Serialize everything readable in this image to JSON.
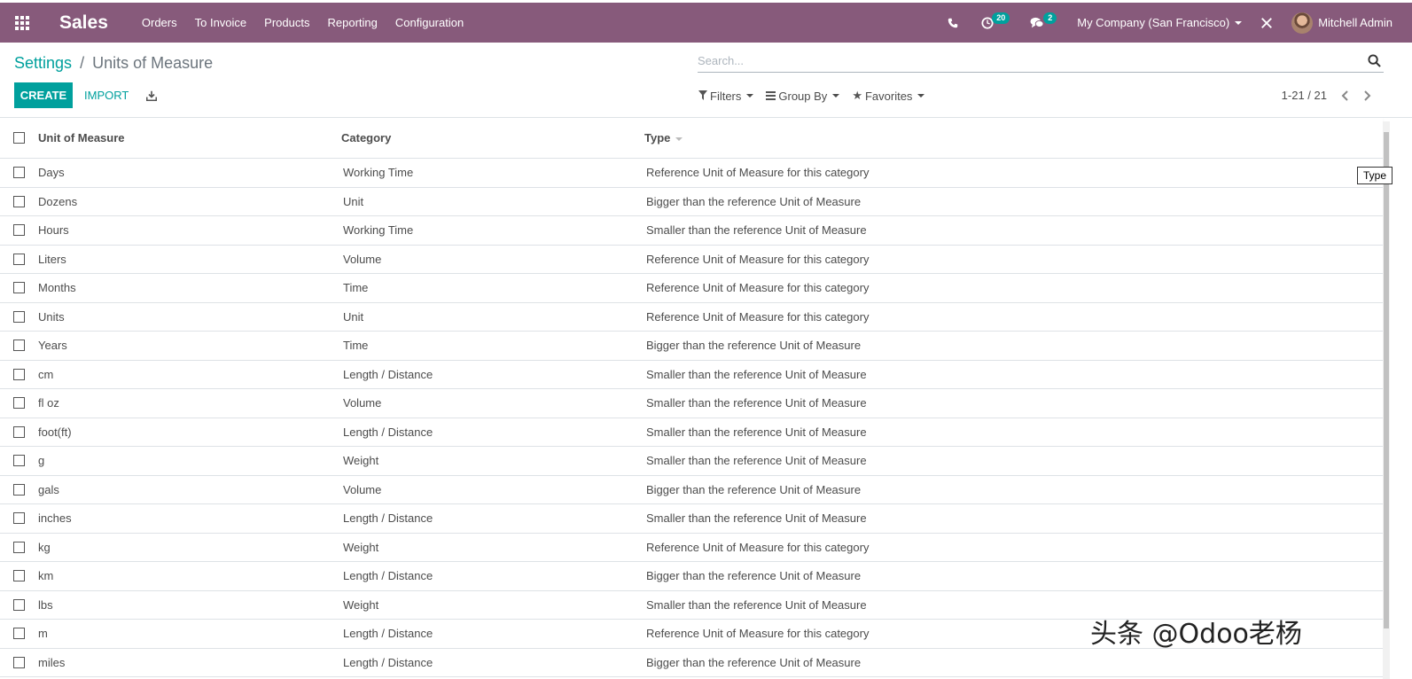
{
  "app": {
    "title": "Sales"
  },
  "menu": [
    {
      "label": "Orders"
    },
    {
      "label": "To Invoice"
    },
    {
      "label": "Products"
    },
    {
      "label": "Reporting"
    },
    {
      "label": "Configuration"
    }
  ],
  "systray": {
    "activity_count": "20",
    "messages_count": "2",
    "company": "My Company (San Francisco)",
    "user": "Mitchell Admin"
  },
  "breadcrumb": {
    "parent": "Settings",
    "separator": "/",
    "current": "Units of Measure"
  },
  "search": {
    "placeholder": "Search..."
  },
  "buttons": {
    "create": "CREATE",
    "import": "IMPORT"
  },
  "facets": {
    "filters": "Filters",
    "group_by": "Group By",
    "favorites": "Favorites"
  },
  "pager": {
    "value": "1-21 / 21"
  },
  "table": {
    "headers": {
      "name": "Unit of Measure",
      "category": "Category",
      "type": "Type"
    },
    "rows": [
      {
        "name": "Days",
        "category": "Working Time",
        "type": "Reference Unit of Measure for this category"
      },
      {
        "name": "Dozens",
        "category": "Unit",
        "type": "Bigger than the reference Unit of Measure"
      },
      {
        "name": "Hours",
        "category": "Working Time",
        "type": "Smaller than the reference Unit of Measure"
      },
      {
        "name": "Liters",
        "category": "Volume",
        "type": "Reference Unit of Measure for this category"
      },
      {
        "name": "Months",
        "category": "Time",
        "type": "Reference Unit of Measure for this category"
      },
      {
        "name": "Units",
        "category": "Unit",
        "type": "Reference Unit of Measure for this category"
      },
      {
        "name": "Years",
        "category": "Time",
        "type": "Bigger than the reference Unit of Measure"
      },
      {
        "name": "cm",
        "category": "Length / Distance",
        "type": "Smaller than the reference Unit of Measure"
      },
      {
        "name": "fl oz",
        "category": "Volume",
        "type": "Smaller than the reference Unit of Measure"
      },
      {
        "name": "foot(ft)",
        "category": "Length / Distance",
        "type": "Smaller than the reference Unit of Measure"
      },
      {
        "name": "g",
        "category": "Weight",
        "type": "Smaller than the reference Unit of Measure"
      },
      {
        "name": "gals",
        "category": "Volume",
        "type": "Bigger than the reference Unit of Measure"
      },
      {
        "name": "inches",
        "category": "Length / Distance",
        "type": "Smaller than the reference Unit of Measure"
      },
      {
        "name": "kg",
        "category": "Weight",
        "type": "Reference Unit of Measure for this category"
      },
      {
        "name": "km",
        "category": "Length / Distance",
        "type": "Bigger than the reference Unit of Measure"
      },
      {
        "name": "lbs",
        "category": "Weight",
        "type": "Smaller than the reference Unit of Measure"
      },
      {
        "name": "m",
        "category": "Length / Distance",
        "type": "Reference Unit of Measure for this category"
      },
      {
        "name": "miles",
        "category": "Length / Distance",
        "type": "Bigger than the reference Unit of Measure"
      }
    ]
  },
  "tooltip": {
    "text": "Type"
  },
  "watermark": {
    "text": "头条 @Odoo老杨"
  },
  "colors": {
    "topbar": "#875a7b",
    "accent": "#00a09d"
  }
}
